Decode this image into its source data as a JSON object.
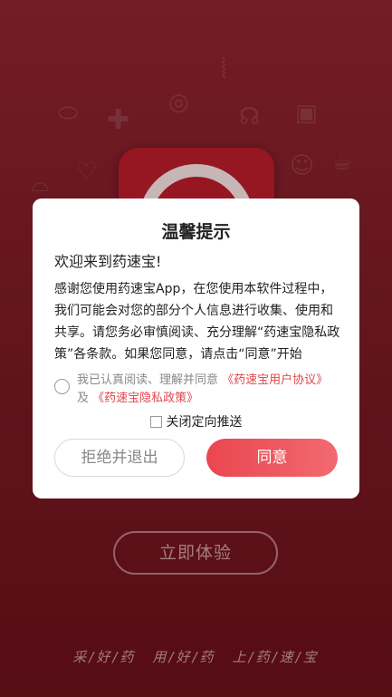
{
  "background": {
    "start_button_label": "立即体验",
    "slogan": "采/好/药　用/好/药　上/药/速/宝"
  },
  "dialog": {
    "title": "温馨提示",
    "welcome": "欢迎来到药速宝!",
    "body": "感谢您使用药速宝App，在您使用本软件过程中，我们可能会对您的部分个人信息进行收集、使用和共享。请您务必审慎阅读、充分理解“药速宝隐私政策”各条款。如果您同意，请点击“同意”开始",
    "agree_prefix": "我已认真阅读、理解并同意",
    "user_agreement_link": "《药速宝用户协议》",
    "and_text": "及",
    "privacy_link": "《药速宝隐私政策》",
    "push_label": "关闭定向推送",
    "reject_label": "拒绝并退出",
    "agree_label": "同意"
  },
  "colors": {
    "accent": "#e8464e",
    "background": "#7a1a24"
  }
}
